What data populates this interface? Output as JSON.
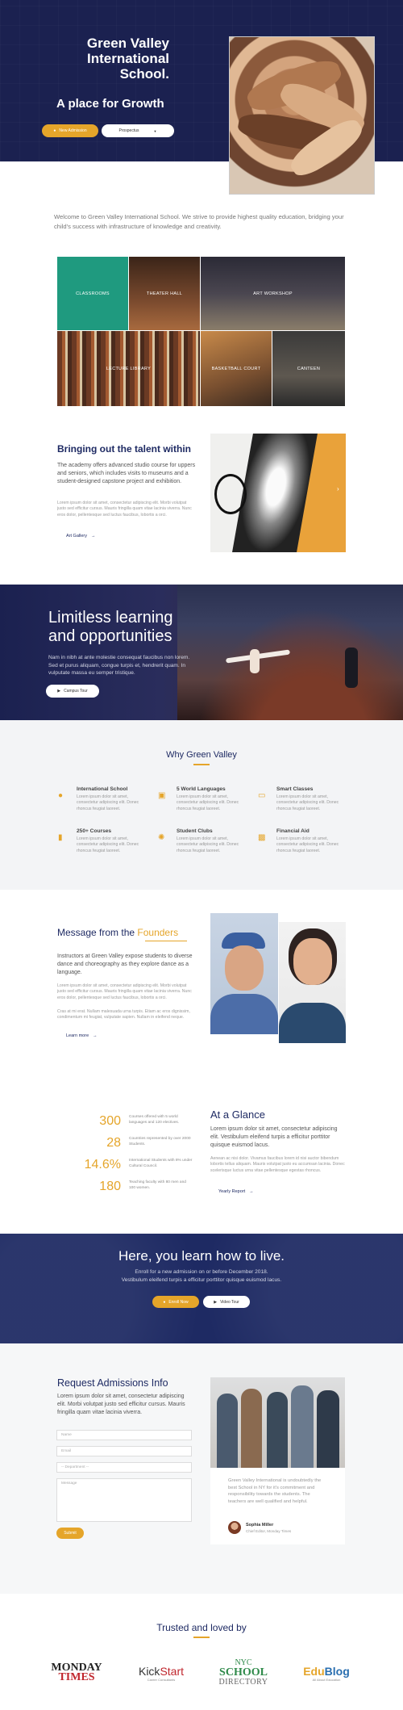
{
  "hero": {
    "title_lines": [
      "Green Valley",
      "International",
      "School."
    ],
    "tagline": "A place for Growth",
    "admission_button": "New Admission",
    "prospectus_select": "Prospectus"
  },
  "welcome": {
    "text": "Welcome to Green Valley International School. We strive to provide highest quality education, bridging your child's success with infrastructure of knowledge and creativity."
  },
  "gallery": {
    "tiles": [
      "CLASSROOMS",
      "THEATER HALL",
      "ART WORKSHOP",
      "LECTURE LIBRARY",
      "BASKETBALL COURT",
      "CANTEEN"
    ]
  },
  "talent": {
    "heading": "Bringing out the talent within",
    "intro": "The academy offers advanced studio course for uppers and seniors, which includes visits to museums and a student-designed capstone project and exhibition.",
    "lorem": "Lorem ipsum dolor sit amet, consectetur adipiscing elit. Morbi volutpat justo sed efficitur cursus. Mauris fringilla quam vitae lacinia viverra. Nunc eros dolor, pellentesque sed luctus faucibus, lobortis a orci.",
    "link": "Art Gallery"
  },
  "limitless": {
    "heading_lines": [
      "Limitless learning",
      "and opportunities"
    ],
    "text": "Nam in nibh at ante molestie consequat faucibus non lorem. Sed et purus aliquam, congue turpis et, hendrerit quam. In vulputate massa eu semper tristique.",
    "button": "Campus Tour"
  },
  "why": {
    "heading": "Why Green Valley",
    "features": [
      {
        "title": "International School",
        "icon": "globe-icon",
        "text": "Lorem ipsum dolor sit amet, consectetur adipiscing elit. Donec rhoncus feugiat laoreet."
      },
      {
        "title": "5 World Languages",
        "icon": "language-icon",
        "text": "Lorem ipsum dolor sit amet, consectetur adipiscing elit. Donec rhoncus feugiat laoreet."
      },
      {
        "title": "Smart Classes",
        "icon": "laptop-icon",
        "text": "Lorem ipsum dolor sit amet, consectetur adipiscing elit. Donec rhoncus feugiat laoreet."
      },
      {
        "title": "250+ Courses",
        "icon": "book-icon",
        "text": "Lorem ipsum dolor sit amet, consectetur adipiscing elit. Donec rhoncus feugiat laoreet."
      },
      {
        "title": "Student Clubs",
        "icon": "ball-icon",
        "text": "Lorem ipsum dolor sit amet, consectetur adipiscing elit. Donec rhoncus feugiat laoreet."
      },
      {
        "title": "Financial Aid",
        "icon": "money-icon",
        "text": "Lorem ipsum dolor sit amet, consectetur adipiscing elit. Donec rhoncus feugiat laoreet."
      }
    ]
  },
  "message": {
    "heading_prefix": "Message from the",
    "heading_accent": "Founders",
    "intro": "Instructors at Green Valley expose students to diverse dance and choreography as they explore dance as a language.",
    "lorem1": "Lorem ipsum dolor sit amet, consectetur adipiscing elit. Morbi volutpat justo sed efficitur cursus. Mauris fringilla quam vitae lacinia viverra. Nunc eros dolor, pellentesque sed luctus faucibus, lobortis a orci.",
    "lorem2": "Cras at mi erat. Nullam malesuada urna turpis. Etiam ac eros dignissim, condimentum mi feugiat, vulputate sapien. Nullam in eleifend neque.",
    "link": "Learn more"
  },
  "glance": {
    "heading": "At a Glance",
    "stats": [
      {
        "value": "300",
        "label": "Courses offered with 5 world languages and 120 electives."
      },
      {
        "value": "28",
        "label": "Countries represented by over 2000 Students."
      },
      {
        "value": "14.6%",
        "label": "International Students with 8% under Cultural Council."
      },
      {
        "value": "180",
        "label": "Teaching faculty with 80 men and 100 women."
      }
    ],
    "intro": "Lorem ipsum dolor sit amet, consectetur adipiscing elit. Vestibulum eleifend turpis a efficitur porttitor quisque euismod lacus.",
    "lorem": "Aenean ac nisi dolor. Vivamus faucibus lorem id nisi auctor bibendum lobortis tellus aliquam. Mauris volutpat justo eu accumsan lacinia. Donec scelerisque luctus urna vitae pellentesque egestas rhoncus.",
    "link": "Yearly Report"
  },
  "cta": {
    "heading": "Here, you learn how to live.",
    "line1": "Enroll for a new admission on or before December 2018.",
    "line2": "Vestibulum eleifend turpis a efficitur porttitor quisque euismod lacus.",
    "enroll_button": "Enroll Now",
    "video_button": "Video Tour"
  },
  "admissions": {
    "heading": "Request Admissions Info",
    "intro": "Lorem ipsum dolor sit amet, consectetur adipiscing elit. Morbi volutpat justo sed efficitur cursus. Mauris fringilla quam vitae lacinia viverra.",
    "name_placeholder": "Name",
    "email_placeholder": "Email",
    "department_select": "-- Department --",
    "message_placeholder": "Message",
    "submit": "Submit",
    "quote": "Green Valley International is undoubtedly the best School in NY for it's commitment and responsibility towards the students. The teachers are well qualified and helpful.",
    "author": "Sophia Miller",
    "author_role": "Chief Editor, Monday Times"
  },
  "trusted": {
    "heading": "Trusted and loved by",
    "logos": {
      "monday_1": "MONDAY",
      "monday_2": "TIMES",
      "kick": "Kick",
      "start": "Start",
      "kick_sub": "Career Consultants",
      "nyc": "NYC",
      "school": "SCHOOL",
      "directory": "DIRECTORY",
      "edu": "Edu",
      "blog": "Blog",
      "edu_sub": "All About Education"
    }
  },
  "colors": {
    "navy": "#1e2a63",
    "gold": "#e5a52a",
    "teal": "#1f9a7f"
  }
}
